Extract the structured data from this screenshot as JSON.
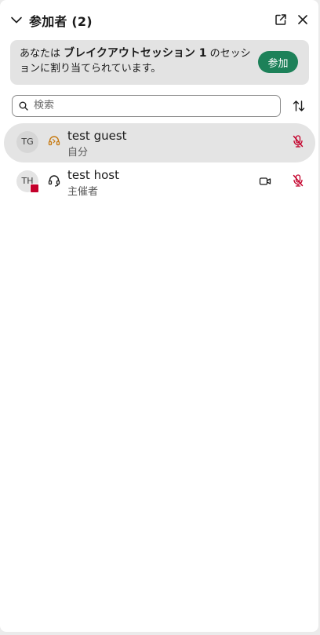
{
  "header": {
    "title": "参加者 (2)"
  },
  "banner": {
    "text_before": "あなたは ",
    "session_name": "ブレイクアウトセッション 1",
    "text_after": " のセッションに割り当てられています。",
    "join_label": "参加"
  },
  "search": {
    "placeholder": "検索",
    "value": ""
  },
  "participants": [
    {
      "initials": "TG",
      "name": "test guest",
      "role": "自分",
      "audio_icon": "headset-connected-icon",
      "muted": true
    },
    {
      "initials": "TH",
      "name": "test host",
      "role": "主催者",
      "audio_icon": "headset-icon",
      "video_icon": "video-camera-icon",
      "muted": true
    }
  ],
  "colors": {
    "accent": "#1d8159",
    "muted": "#c4002b",
    "audio_active": "#c77a12",
    "row_highlight": "#e4e4e4",
    "banner_bg": "#e3e3e3"
  }
}
